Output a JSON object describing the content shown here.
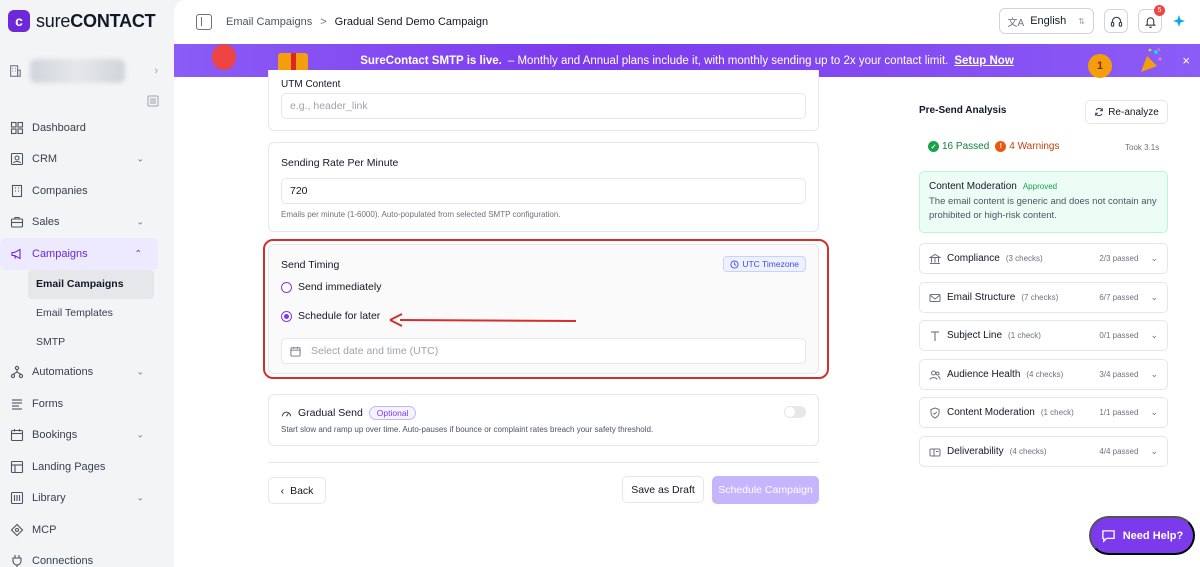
{
  "brand": {
    "name_prefix": "sure",
    "name_suffix": "CONTACT",
    "accent": "#7c3aed"
  },
  "sidebar": {
    "items": [
      {
        "label": "Dashboard",
        "icon": "dashboard-icon"
      },
      {
        "label": "CRM",
        "icon": "crm-icon",
        "has_chevron": true
      },
      {
        "label": "Companies",
        "icon": "building-icon"
      },
      {
        "label": "Sales",
        "icon": "briefcase-icon",
        "has_chevron": true
      },
      {
        "label": "Campaigns",
        "icon": "megaphone-icon",
        "has_chevron": true,
        "active": true
      },
      {
        "label": "Automations",
        "icon": "workflow-icon",
        "has_chevron": true
      },
      {
        "label": "Forms",
        "icon": "forms-icon"
      },
      {
        "label": "Bookings",
        "icon": "calendar-icon",
        "has_chevron": true
      },
      {
        "label": "Landing Pages",
        "icon": "layout-icon"
      },
      {
        "label": "Library",
        "icon": "library-icon",
        "has_chevron": true
      },
      {
        "label": "MCP",
        "icon": "mcp-icon"
      },
      {
        "label": "Connections",
        "icon": "plug-icon"
      }
    ],
    "sub_items": [
      {
        "label": "Email Campaigns",
        "active": true
      },
      {
        "label": "Email Templates"
      },
      {
        "label": "SMTP"
      }
    ]
  },
  "header": {
    "breadcrumb_parent": "Email Campaigns",
    "breadcrumb_separator": ">",
    "breadcrumb_current": "Gradual Send Demo Campaign",
    "language": "English",
    "notification_count": "5"
  },
  "banner": {
    "headline": "SureContact SMTP is live.",
    "text": "– Monthly and Annual plans include it, with monthly sending up to 2x your contact limit.",
    "link": "Setup Now",
    "medal_text": "1",
    "close": "×"
  },
  "form": {
    "utm_content": {
      "label": "UTM Content",
      "placeholder": "e.g., header_link"
    },
    "sending_rate": {
      "label": "Sending Rate Per Minute",
      "value": "720",
      "hint": "Emails per minute (1-6000). Auto-populated from selected SMTP configuration."
    },
    "send_timing": {
      "label": "Send Timing",
      "timezone_badge": "UTC Timezone",
      "option_immediate": "Send immediately",
      "option_schedule": "Schedule for later",
      "selected": "schedule",
      "date_placeholder": "Select date and time (UTC)"
    },
    "gradual_send": {
      "label": "Gradual Send",
      "badge": "Optional",
      "enabled": false,
      "description": "Start slow and ramp up over time. Auto-pauses if bounce or complaint rates breach your safety threshold."
    }
  },
  "actions": {
    "back": "Back",
    "save_draft": "Save as Draft",
    "schedule": "Schedule Campaign"
  },
  "analysis": {
    "title": "Pre-Send Analysis",
    "reanalyze": "Re-analyze",
    "passed": "16 Passed",
    "warnings": "4 Warnings",
    "took": "Took 3.1s",
    "moderation": {
      "title": "Content Moderation",
      "status": "Approved",
      "text": "The email content is generic and does not contain any prohibited or high-risk content."
    },
    "checks": [
      {
        "name": "Compliance",
        "count": "(3 checks)",
        "result": "2/3 passed",
        "icon": "bank-icon"
      },
      {
        "name": "Email Structure",
        "count": "(7 checks)",
        "result": "6/7 passed",
        "icon": "envelope-icon"
      },
      {
        "name": "Subject Line",
        "count": "(1 check)",
        "result": "0/1 passed",
        "icon": "text-icon"
      },
      {
        "name": "Audience Health",
        "count": "(4 checks)",
        "result": "3/4 passed",
        "icon": "users-icon"
      },
      {
        "name": "Content Moderation",
        "count": "(1 check)",
        "result": "1/1 passed",
        "icon": "shield-icon"
      },
      {
        "name": "Deliverability",
        "count": "(4 checks)",
        "result": "4/4 passed",
        "icon": "mailbox-icon"
      }
    ]
  },
  "help": {
    "label": "Need Help?"
  },
  "colors": {
    "annotation_red": "#d32f2f",
    "banner_purple": "#7c3aed",
    "approved_green": "#16a34a"
  }
}
